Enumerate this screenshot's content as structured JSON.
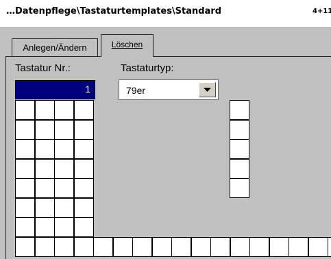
{
  "window": {
    "title": "…Datenpflege\\Tastaturtemplates\\Standard",
    "title_right": "4+11"
  },
  "tabs": [
    {
      "label": "Anlegen/Ändern",
      "active": false
    },
    {
      "label": "Löschen",
      "active": true
    }
  ],
  "form": {
    "keyboard_no_label": "Tastatur Nr.:",
    "keyboard_no_value": "1",
    "keyboard_type_label": "Tastaturtyp:",
    "keyboard_type_value": "79er"
  },
  "colors": {
    "background": "#c0c0c0",
    "selection": "#00007f",
    "key_fill": "#ffffff"
  },
  "icons": {
    "dropdown": "chevron-down-icon"
  }
}
